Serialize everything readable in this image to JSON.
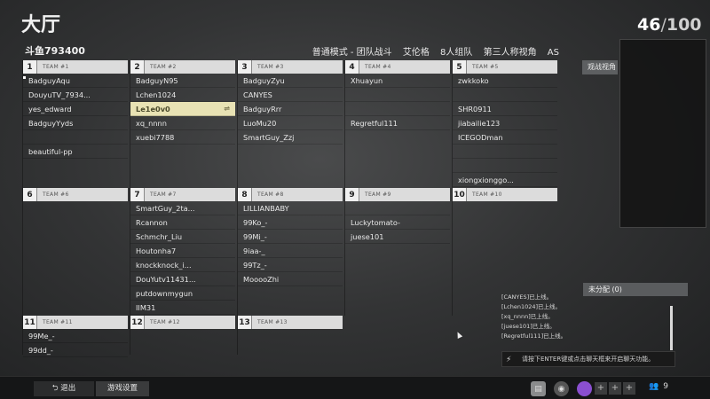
{
  "header": {
    "title": "大厅",
    "channel": "斗鱼793400",
    "mode": [
      "普通模式 - 团队战斗",
      "艾伦格",
      "8人组队",
      "第三人称视角",
      "AS"
    ],
    "players_current": "46",
    "players_separator": "/",
    "players_max": "100"
  },
  "teams": [
    {
      "num": "1",
      "label": "TEAM #1",
      "players": [
        "BadguyAqu",
        "DouyuTV_7934...",
        "yes_edward",
        "BadguyYyds",
        "",
        "beautiful-pp"
      ]
    },
    {
      "num": "2",
      "label": "TEAM #2",
      "players": [
        "BadguyN95",
        "Lchen1024",
        "Le1e0v0",
        "xq_nnnn",
        "xuebi7788"
      ]
    },
    {
      "num": "3",
      "label": "TEAM #3",
      "players": [
        "BadguyZyu",
        "CANYES",
        "BadguyRrr",
        "LuoMu20",
        "SmartGuy_Zzj"
      ]
    },
    {
      "num": "4",
      "label": "TEAM #4",
      "players": [
        "Xhuayun",
        "",
        "",
        "Regretful111"
      ]
    },
    {
      "num": "5",
      "label": "TEAM #5",
      "players": [
        "zwkkoko",
        "",
        "SHR0911",
        "jiabailie123",
        "ICEGODman",
        "",
        "",
        "xiongxionggo..."
      ]
    },
    {
      "num": "6",
      "label": "TEAM #6",
      "players": []
    },
    {
      "num": "7",
      "label": "TEAM #7",
      "players": [
        "SmartGuy_2ta...",
        "Rcannon",
        "Schmchr_Liu",
        "Houtonha7",
        "knockknock_i...",
        "DouYutv11431...",
        "putdownmygun",
        "IIM31"
      ]
    },
    {
      "num": "8",
      "label": "TEAM #8",
      "players": [
        "LILLIANBABY",
        "99Ko_-",
        "99Mi_-",
        "9iaa-_",
        "99Tz_-",
        "MooooZhi"
      ]
    },
    {
      "num": "9",
      "label": "TEAM #9",
      "players": [
        "",
        "Luckytomato-",
        "juese101"
      ]
    },
    {
      "num": "10",
      "label": "TEAM #10",
      "players": []
    },
    {
      "num": "11",
      "label": "TEAM #11",
      "players": [
        "99Me_-",
        "99dd_-"
      ]
    },
    {
      "num": "12",
      "label": "TEAM #12",
      "players": []
    },
    {
      "num": "13",
      "label": "TEAM #13",
      "players": []
    }
  ],
  "self_player": "Le1e0v0",
  "watch_label": "观战视角",
  "unassigned_label": "未分配 (0)",
  "chat_log": [
    "[CANYES]已上线。",
    "[Lchen1024]已上线。",
    "[xq_nnnn]已上线。",
    "[juese101]已上线。",
    "[Regretful111]已上线。"
  ],
  "chat_placeholder": "请按下ENTER键或点击聊天框来开启聊天功能。",
  "bottom": {
    "back_label": "退出",
    "settings_label": "游戏设置",
    "party_count": "9"
  },
  "colors": {
    "accent_self": "#e8e2b4",
    "team_header": "#dcdcdc",
    "avatar": "#8a4fd0"
  }
}
